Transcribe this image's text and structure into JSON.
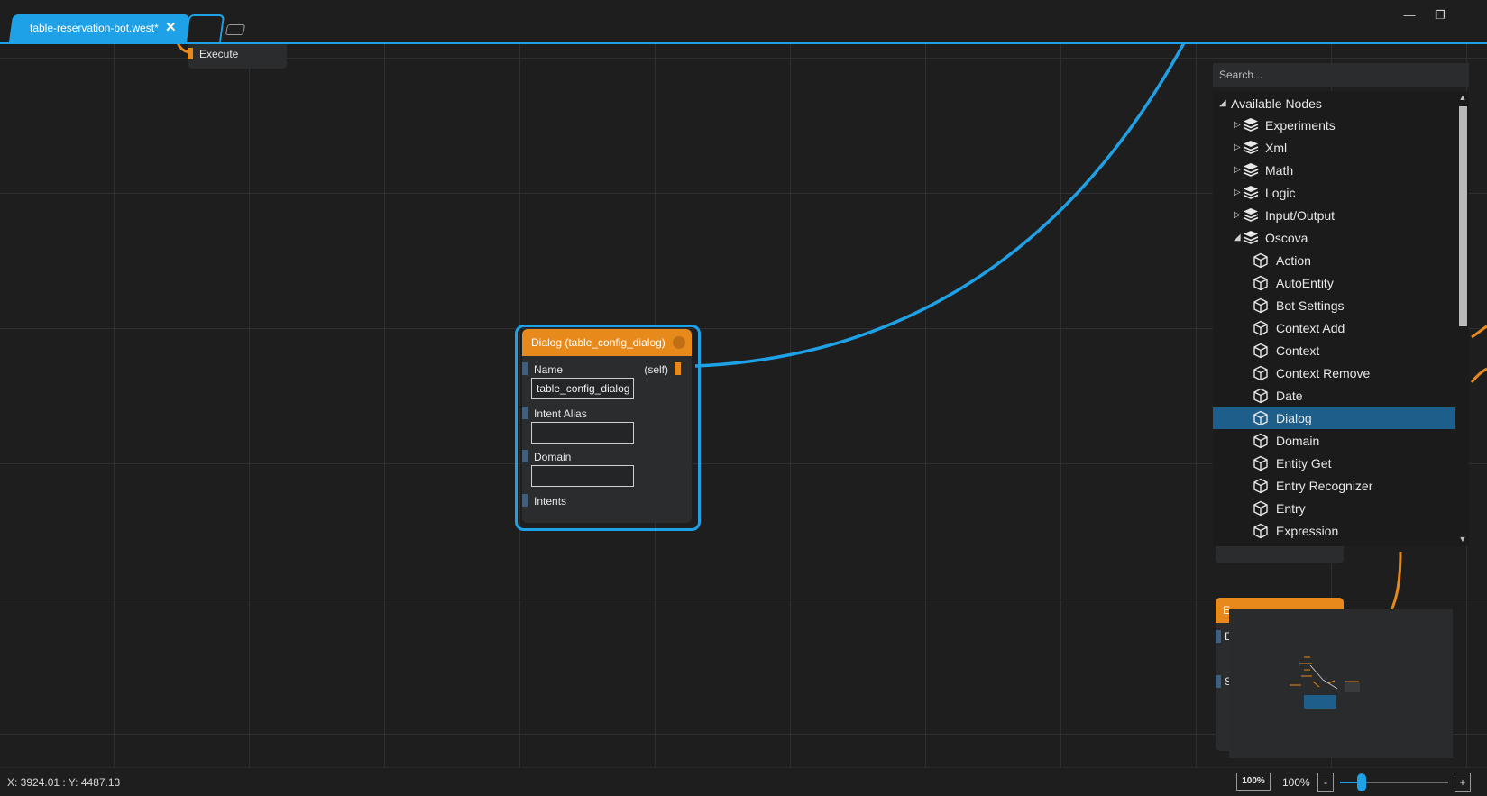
{
  "tabs": {
    "active_label": "table-reservation-bot.west*",
    "close_symbol": "✕"
  },
  "window_controls": {
    "minimize": "—",
    "restore": "❐"
  },
  "execute_node": {
    "port_label": "Execute"
  },
  "dialog_node": {
    "title": "Dialog (table_config_dialog)",
    "fields": {
      "name_label": "Name",
      "name_output": "(self)",
      "name_value": "table_config_dialog",
      "intent_alias_label": "Intent Alias",
      "intent_alias_value": "",
      "domain_label": "Domain",
      "domain_value": "",
      "intents_label": "Intents"
    }
  },
  "palette": {
    "search_placeholder": "Search...",
    "root": "Available Nodes",
    "categories": [
      "Experiments",
      "Xml",
      "Math",
      "Logic",
      "Input/Output",
      "Oscova"
    ],
    "oscova_items": [
      "Action",
      "AutoEntity",
      "Bot Settings",
      "Context Add",
      "Context",
      "Context Remove",
      "Date",
      "Dialog",
      "Domain",
      "Entity Get",
      "Entry Recognizer",
      "Entry",
      "Expression"
    ],
    "selected": "Dialog"
  },
  "stub_node": {
    "title_fragment": "E",
    "ports": [
      "E",
      "S"
    ]
  },
  "status": {
    "coordinates": "X: 3924.01 : Y: 4487.13",
    "zoom_badge": "100%",
    "zoom_text": "100%",
    "zoom_minus": "-",
    "zoom_plus": "+",
    "zoom_level": 0.2
  },
  "colors": {
    "accent": "#1ea1e6",
    "node_orange": "#e8891c",
    "selection": "#1d5f8a",
    "canvas": "#1e1e1f"
  }
}
